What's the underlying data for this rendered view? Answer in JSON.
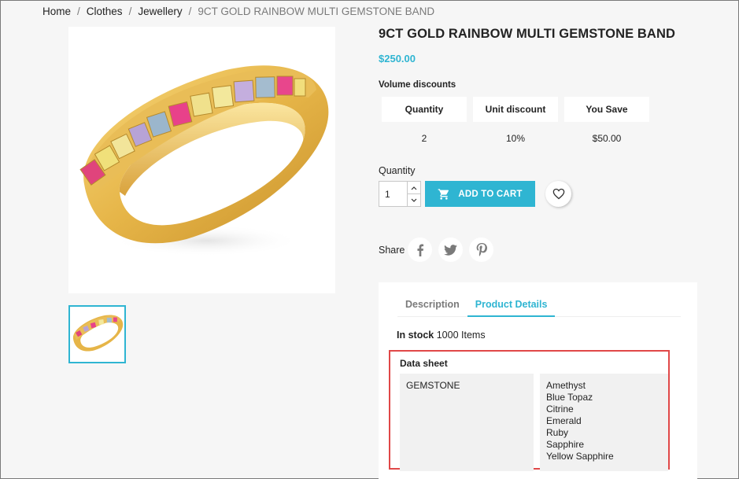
{
  "breadcrumb": {
    "items": [
      "Home",
      "Clothes",
      "Jewellery"
    ],
    "current": "9CT GOLD RAINBOW MULTI GEMSTONE BAND",
    "separator": "/"
  },
  "product": {
    "title": "9CT GOLD RAINBOW MULTI GEMSTONE BAND",
    "price": "$250.00"
  },
  "volume_discounts": {
    "title": "Volume discounts",
    "headers": [
      "Quantity",
      "Unit discount",
      "You Save"
    ],
    "rows": [
      [
        "2",
        "10%",
        "$50.00"
      ]
    ]
  },
  "quantity": {
    "label": "Quantity",
    "value": "1"
  },
  "actions": {
    "add_to_cart": "ADD TO CART"
  },
  "share": {
    "label": "Share"
  },
  "tabs": {
    "description": "Description",
    "product_details": "Product Details",
    "active": "product_details"
  },
  "details": {
    "stock_label": "In stock",
    "stock_value": "1000 Items",
    "data_sheet_title": "Data sheet",
    "feature_name": "GEMSTONE",
    "feature_values": [
      "Amethyst",
      "Blue Topaz",
      "Citrine",
      "Emerald",
      "Ruby",
      "Sapphire",
      "Yellow Sapphire"
    ]
  },
  "colors": {
    "accent": "#2fb5d2",
    "highlight_border": "#e04848",
    "background": "#f6f6f6"
  }
}
